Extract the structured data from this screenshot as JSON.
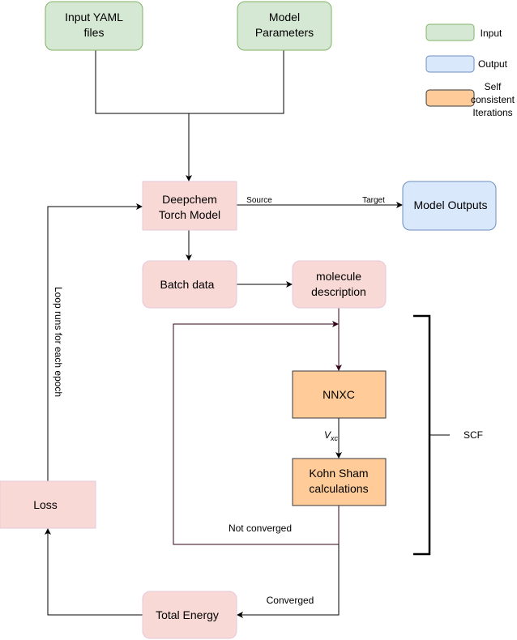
{
  "nodes": {
    "input_yaml": {
      "line1": "Input YAML",
      "line2": "files"
    },
    "model_parameters": {
      "line1": "Model",
      "line2": "Parameters"
    },
    "deepchem": {
      "line1": "Deepchem",
      "line2": "Torch Model"
    },
    "model_outputs": {
      "line1": "Model Outputs"
    },
    "batch_data": {
      "line1": "Batch data"
    },
    "molecule_description": {
      "line1": "molecule",
      "line2": "description"
    },
    "nnxc": {
      "line1": "NNXC"
    },
    "kohn_sham": {
      "line1": "Kohn Sham",
      "line2": "calculations"
    },
    "total_energy": {
      "line1": "Total Energy"
    },
    "loss": {
      "line1": "Loss"
    }
  },
  "edge_labels": {
    "source": "Source",
    "target": "Target",
    "vxc_main": "V",
    "vxc_sub": "xc",
    "not_converged": "Not converged",
    "converged": "Converged",
    "epoch_loop": "Loop runs for each epoch",
    "scf": "SCF"
  },
  "legend": {
    "input": "Input",
    "output": "Output",
    "scf_line1": "Self",
    "scf_line2": "consistent",
    "scf_line3": "Iterations"
  },
  "colors": {
    "input_fill": "#d5e8d4",
    "input_stroke": "#82b366",
    "output_fill": "#dae8fc",
    "output_stroke": "#6c8ebf",
    "scf_fill": "#ffcc99",
    "scf_stroke": "#36393d",
    "process_fill": "#f8d9d6",
    "process_stroke": "#e6c9dc",
    "loop_edge": "#33001a"
  }
}
